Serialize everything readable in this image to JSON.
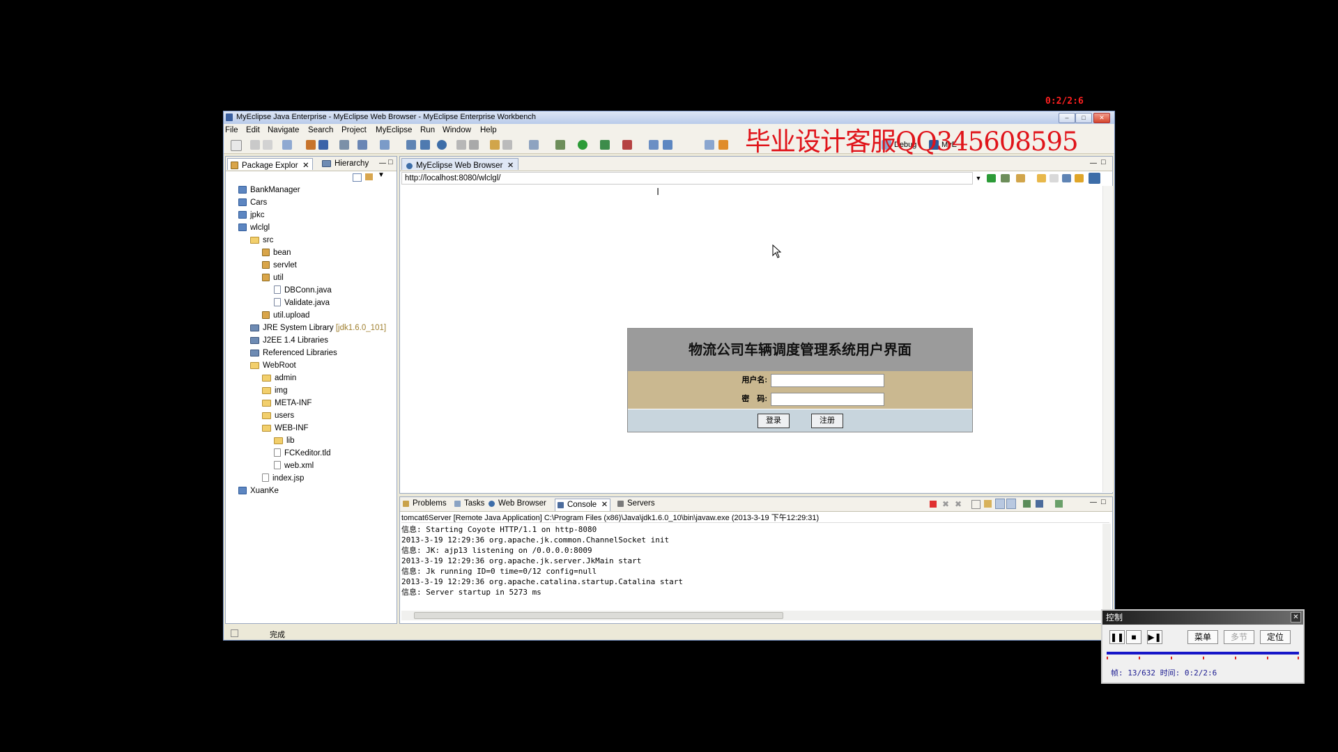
{
  "timer": "0:2/2:6",
  "window": {
    "title": "MyEclipse Java Enterprise - MyEclipse Web Browser - MyEclipse Enterprise Workbench",
    "buttons": [
      "minimize",
      "maximize",
      "close"
    ]
  },
  "watermark": "毕业设计客服QQ345608595",
  "menu": [
    "File",
    "Edit",
    "Navigate",
    "Search",
    "Project",
    "MyEclipse",
    "Run",
    "Window",
    "Help"
  ],
  "perspectives": {
    "debug": "Debug",
    "myeclipse": "MyE"
  },
  "left_pane": {
    "tabs": [
      "Package Explor",
      "Hierarchy"
    ],
    "tree": [
      {
        "label": "BankManager",
        "icon": "project-icon",
        "depth": 0
      },
      {
        "label": "Cars",
        "icon": "project-icon",
        "depth": 0
      },
      {
        "label": "jpkc",
        "icon": "project-icon",
        "depth": 0
      },
      {
        "label": "wlclgl",
        "icon": "project-icon",
        "depth": 0
      },
      {
        "label": "src",
        "icon": "source-folder-icon",
        "depth": 1
      },
      {
        "label": "bean",
        "icon": "package-icon",
        "depth": 2
      },
      {
        "label": "servlet",
        "icon": "package-icon",
        "depth": 2
      },
      {
        "label": "util",
        "icon": "package-icon",
        "depth": 2
      },
      {
        "label": "DBConn.java",
        "icon": "java-file-icon",
        "depth": 3
      },
      {
        "label": "Validate.java",
        "icon": "java-file-icon",
        "depth": 3
      },
      {
        "label": "util.upload",
        "icon": "package-icon",
        "depth": 2
      },
      {
        "label": "JRE System Library",
        "suffix": "[jdk1.6.0_101]",
        "icon": "library-icon",
        "depth": 1
      },
      {
        "label": "J2EE 1.4 Libraries",
        "icon": "library-icon",
        "depth": 1
      },
      {
        "label": "Referenced Libraries",
        "icon": "library-icon",
        "depth": 1
      },
      {
        "label": "WebRoot",
        "icon": "folder-icon",
        "depth": 1
      },
      {
        "label": "admin",
        "icon": "folder-icon",
        "depth": 2
      },
      {
        "label": "img",
        "icon": "folder-icon",
        "depth": 2
      },
      {
        "label": "META-INF",
        "icon": "folder-icon",
        "depth": 2
      },
      {
        "label": "users",
        "icon": "folder-icon",
        "depth": 2
      },
      {
        "label": "WEB-INF",
        "icon": "folder-icon",
        "depth": 2
      },
      {
        "label": "lib",
        "icon": "folder-icon",
        "depth": 3
      },
      {
        "label": "FCKeditor.tld",
        "icon": "file-icon",
        "depth": 3
      },
      {
        "label": "web.xml",
        "icon": "file-icon",
        "depth": 3
      },
      {
        "label": "index.jsp",
        "icon": "file-icon",
        "depth": 2
      },
      {
        "label": "XuanKe",
        "icon": "project-icon",
        "depth": 0
      }
    ]
  },
  "editor": {
    "tab": "MyEclipse Web Browser",
    "url": "http://localhost:8080/wlclgl/"
  },
  "login": {
    "title": "物流公司车辆调度管理系统用户界面",
    "username_label": "用户名:",
    "password_label": "密　码:",
    "username_value": "",
    "password_value": "",
    "login_button": "登录",
    "register_button": "注册"
  },
  "console": {
    "tabs": [
      "Problems",
      "Tasks",
      "Web Browser",
      "Console",
      "Servers"
    ],
    "active_tab": "Console",
    "header": "tomcat6Server [Remote Java Application] C:\\Program Files (x86)\\Java\\jdk1.6.0_10\\bin\\javaw.exe (2013-3-19 下午12:29:31)",
    "lines": [
      "信息: Starting Coyote HTTP/1.1 on http-8080",
      "2013-3-19 12:29:36 org.apache.jk.common.ChannelSocket init",
      "信息: JK: ajp13 listening on /0.0.0.0:8009",
      "2013-3-19 12:29:36 org.apache.jk.server.JkMain start",
      "信息: Jk running ID=0 time=0/12  config=null",
      "2013-3-19 12:29:36 org.apache.catalina.startup.Catalina start",
      "信息: Server startup in 5273 ms"
    ]
  },
  "statusbar": {
    "text": "完成"
  },
  "control_panel": {
    "title": "控制",
    "menu_button": "菜单",
    "multi_button": "多节",
    "locate_button": "定位",
    "info": "帧: 13/632 时间: 0:2/2:6",
    "progress": 0.0206
  },
  "colors": {
    "watermark": "#e0141a",
    "timer": "#ff2020",
    "login_header": "#9b9b9b",
    "login_rows": "#cab890",
    "login_buttons_row": "#c8d5dd",
    "progress": "#1616c8"
  }
}
